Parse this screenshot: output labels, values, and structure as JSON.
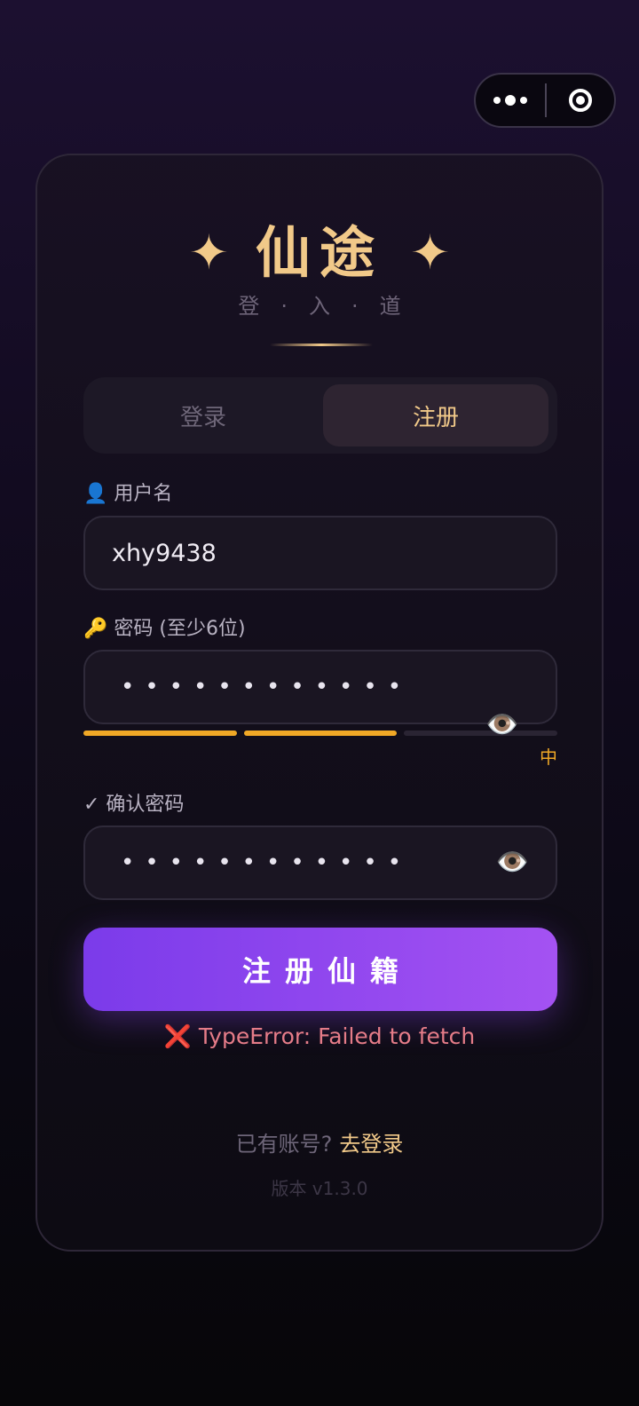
{
  "capsule": {
    "more_icon": "more-dots-icon",
    "close_icon": "target-icon"
  },
  "header": {
    "title": "仙途",
    "subtitle": "登·入·道",
    "star_glyph": "✦"
  },
  "tabs": [
    {
      "label": "登录",
      "active": false
    },
    {
      "label": "注册",
      "active": true
    }
  ],
  "form": {
    "username": {
      "label": "👤 用户名",
      "value": "xhy9438"
    },
    "password": {
      "label": "🔑 密码 (至少6位)",
      "masked": "••••••••••••",
      "eye_icon": "👁️"
    },
    "strength": {
      "level": 2,
      "max": 3,
      "label": "中",
      "color": "#f0a826"
    },
    "confirm": {
      "label": "✓ 确认密码",
      "masked": "••••••••••••",
      "eye_icon": "👁️"
    },
    "submit_label": "注册仙籍",
    "error": "❌ TypeError: Failed to fetch"
  },
  "footer": {
    "question": "已有账号?",
    "link": "去登录",
    "version": "版本 v1.3.0"
  },
  "colors": {
    "gold": "#f1c989",
    "purple_start": "#7b3bea",
    "purple_end": "#a452f2",
    "error": "#e57c88"
  }
}
